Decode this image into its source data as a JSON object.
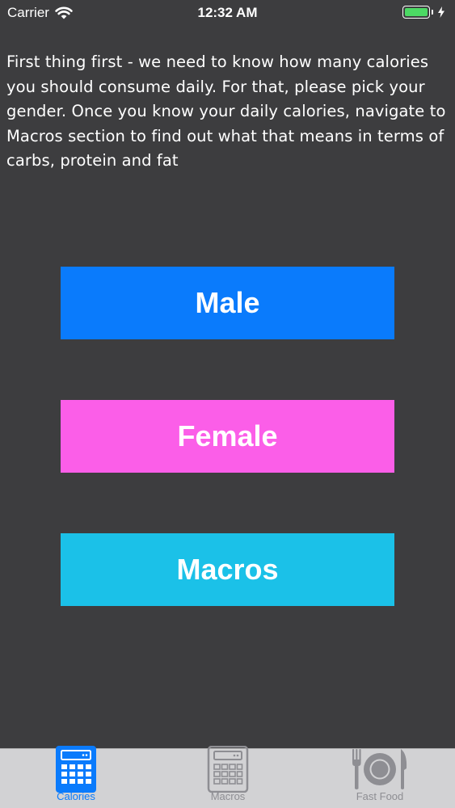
{
  "status_bar": {
    "carrier": "Carrier",
    "time": "12:32 AM",
    "battery_color": "#4cd964"
  },
  "intro_text": "First thing first - we need to know how many calories you should consume daily. For that, please pick your gender. Once you know your daily calories, navigate to Macros section to find out what that means in terms of carbs, protein and fat",
  "buttons": {
    "male": {
      "label": "Male",
      "color": "#0a7bfc"
    },
    "female": {
      "label": "Female",
      "color": "#fb5ee8"
    },
    "macros": {
      "label": "Macros",
      "color": "#1bc1e8"
    }
  },
  "tab_bar": {
    "tabs": [
      {
        "label": "Calories",
        "icon": "calculator-icon",
        "selected": true
      },
      {
        "label": "Macros",
        "icon": "calculator-icon",
        "selected": false
      },
      {
        "label": "Fast Food",
        "icon": "fork-plate-knife-icon",
        "selected": false
      }
    ],
    "active_color": "#0a7bfc",
    "inactive_color": "#8e8e93"
  },
  "background_color": "#3d3d3f"
}
